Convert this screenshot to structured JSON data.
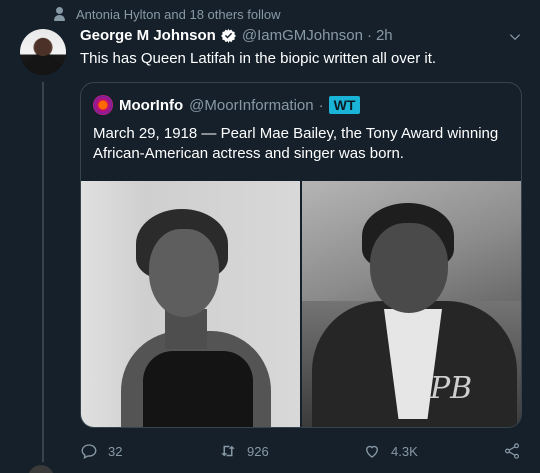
{
  "social_context": {
    "text": "Antonia Hylton and 18 others follow"
  },
  "tweet": {
    "author_name": "George M Johnson",
    "author_handle": "@IamGMJohnson",
    "separator": "·",
    "time": "2h",
    "text": "This has Queen Latifah in the biopic written all over it."
  },
  "quoted_tweet": {
    "author_name": "MoorInfo",
    "author_handle": "@MoorInformation",
    "separator": "·",
    "badge": "WT",
    "text": "March 29, 1918 — Pearl Mae Bailey, the Tony Award winning African-American actress and singer was born.",
    "photos": [
      "photo-left",
      "photo-right"
    ]
  },
  "actions": {
    "reply_count": "32",
    "retweet_count": "926",
    "like_count": "4.3K"
  },
  "colors": {
    "background": "#15202b",
    "secondary_text": "#8899a6",
    "border": "#38444d",
    "badge": "#19b4d8"
  },
  "icons": [
    "person-icon",
    "verified-icon",
    "caret-down-icon",
    "reply-icon",
    "retweet-icon",
    "like-icon",
    "share-icon"
  ]
}
